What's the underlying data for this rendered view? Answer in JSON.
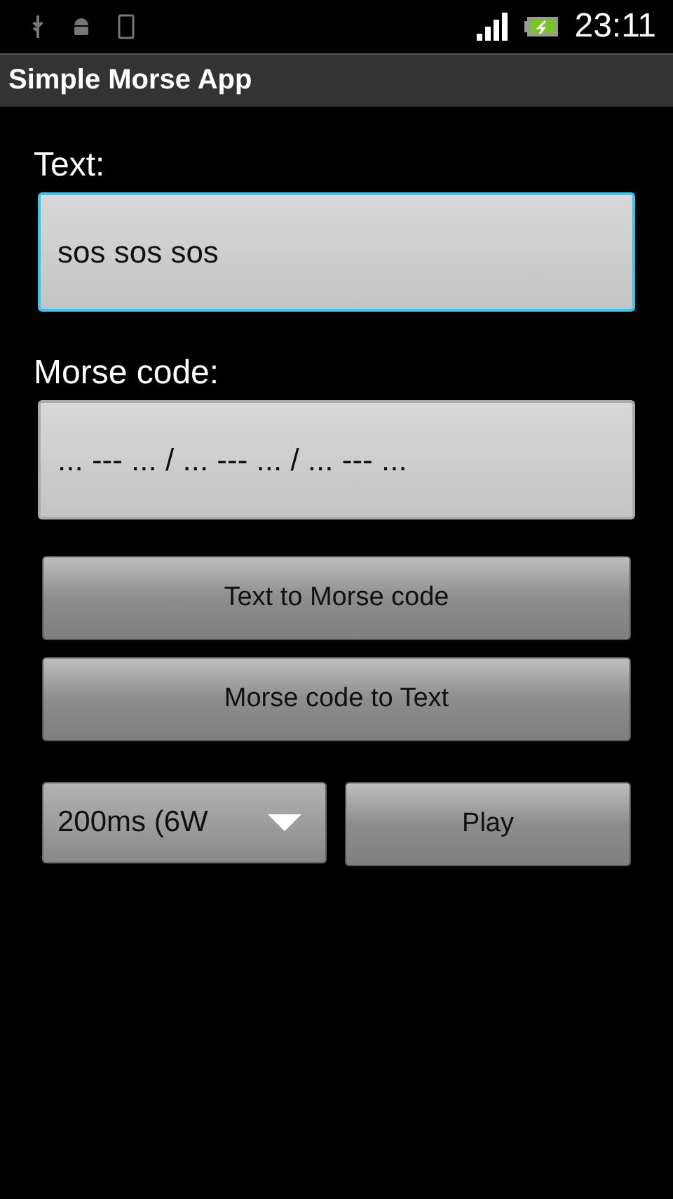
{
  "status_bar": {
    "time": "23:11"
  },
  "title_bar": {
    "title": "Simple Morse App"
  },
  "fields": [
    {
      "label": "Text:",
      "value": "sos sos sos",
      "focused": true
    },
    {
      "label": "Morse code:",
      "value": "... --- ... / ... --- ... / ... --- ...",
      "focused": false
    }
  ],
  "buttons": [
    "Text to Morse code",
    "Morse code to Text"
  ],
  "speed_spinner": {
    "value": "200ms (6W"
  },
  "play_button": "Play"
}
